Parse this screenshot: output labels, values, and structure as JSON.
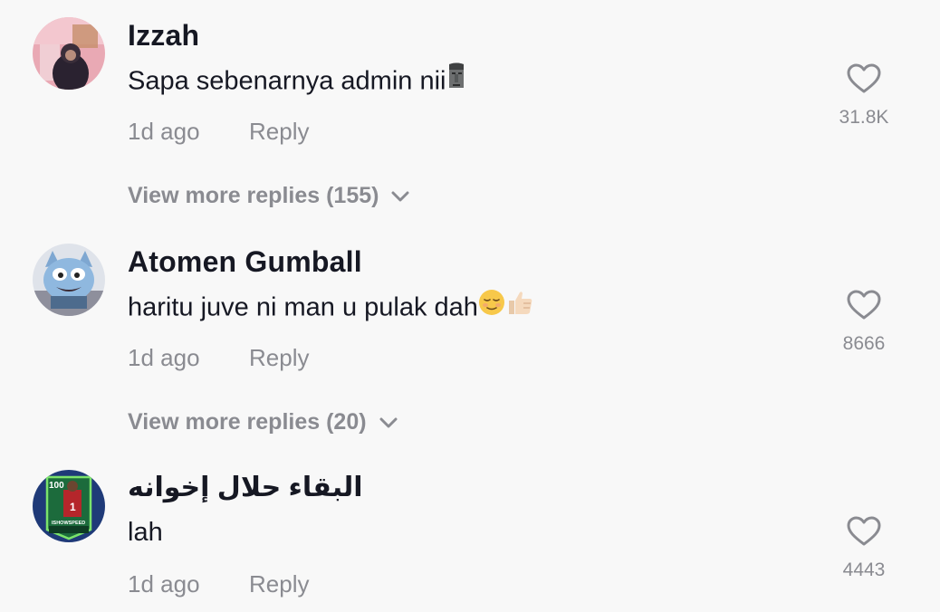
{
  "comments": [
    {
      "username": "Izzah",
      "text": "Sapa sebenarnya admin nii",
      "emoji": [
        "moai-emoji"
      ],
      "time": "1d ago",
      "reply_label": "Reply",
      "likes": "31.8K",
      "view_more": "View more replies (155)",
      "avatar": "user-photo-avatar"
    },
    {
      "username": "Atomen Gumball",
      "text": "haritu juve ni man u pulak dah",
      "emoji": [
        "relieved-face-emoji",
        "thumbs-up-emoji"
      ],
      "time": "1d ago",
      "reply_label": "Reply",
      "likes": "8666",
      "view_more": "View more replies (20)",
      "avatar": "cartoon-cat-avatar"
    },
    {
      "username": "البقاء حلال إخوانه",
      "text": "lah",
      "time": "1d ago",
      "reply_label": "Reply",
      "likes": "4443",
      "avatar": "player-card-avatar",
      "avatar_card": {
        "rating": "100",
        "number": "1",
        "name": "ISHOWSPEED"
      }
    }
  ],
  "colors": {
    "background": "#f8f8f8",
    "primary_text": "#161823",
    "secondary_text": "#8a8b91"
  },
  "icons": {
    "like": "heart-outline-icon",
    "expand": "chevron-down-icon"
  }
}
